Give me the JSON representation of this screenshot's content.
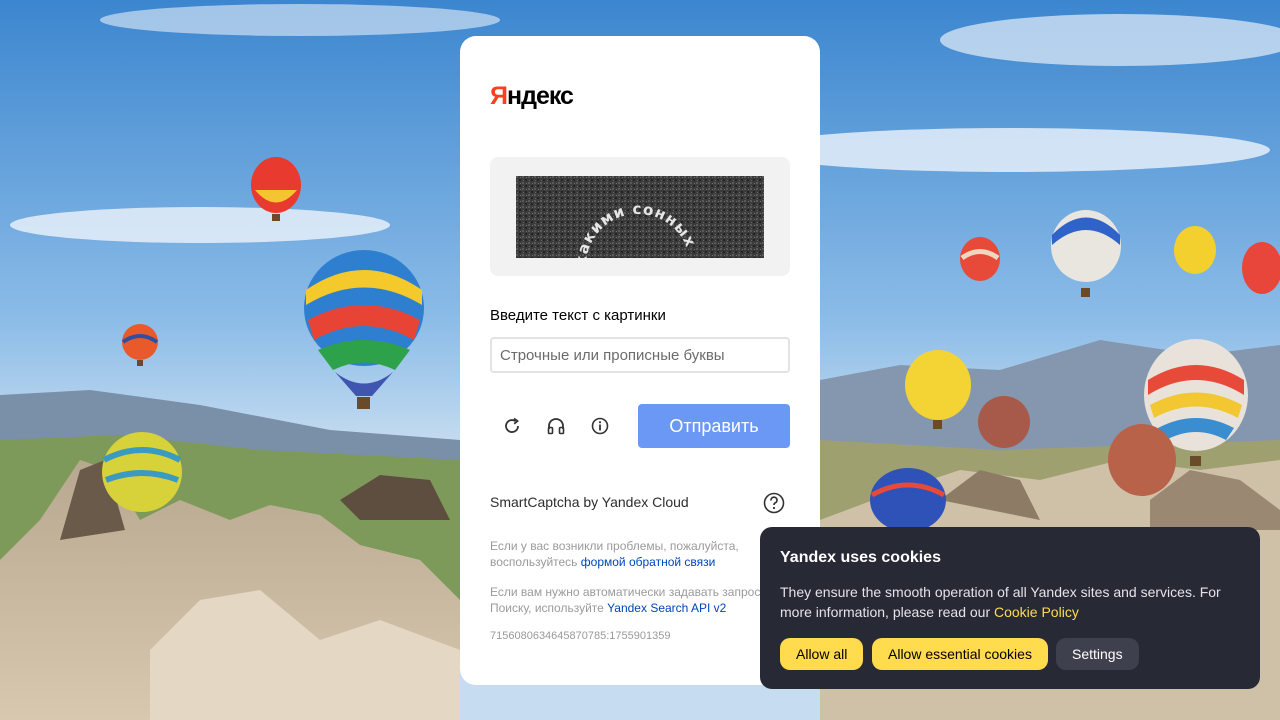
{
  "captcha": {
    "logo": {
      "ya": "Я",
      "rest": "ндекс"
    },
    "image_text": "какими сонных",
    "prompt": "Введите текст с картинки",
    "input": {
      "value": "",
      "placeholder": "Строчные или прописные буквы"
    },
    "icons": {
      "refresh": "refresh-icon",
      "audio": "headphones-icon",
      "info": "info-icon",
      "help": "question-circle-icon"
    },
    "submit_label": "Отправить",
    "brand": "SmartCaptcha by Yandex Cloud",
    "problems": {
      "line1": "Если у вас возникли проблемы, пожалуйста,",
      "line2_prefix": "воспользуйтесь ",
      "link": "формой обратной связи"
    },
    "api": {
      "line1": "Если вам нужно автоматически задавать запросы",
      "line2_prefix": "Поиску, используйте ",
      "link": "Yandex Search API v2"
    },
    "request_id": "7156080634645870785:1755901359"
  },
  "cookie_banner": {
    "title": "Yandex uses cookies",
    "text_prefix": "They ensure the smooth operation of all Yandex sites and services. For more information, please read our ",
    "policy_link": "Cookie Policy",
    "buttons": {
      "allow_all": "Allow all",
      "allow_essential": "Allow essential cookies",
      "settings": "Settings"
    }
  },
  "colors": {
    "accent_button": "#6b98f5",
    "link": "#0044bb",
    "cookie_bg": "#272935",
    "cookie_yellow": "#ffdb4d",
    "logo_red": "#fc3f1d"
  }
}
